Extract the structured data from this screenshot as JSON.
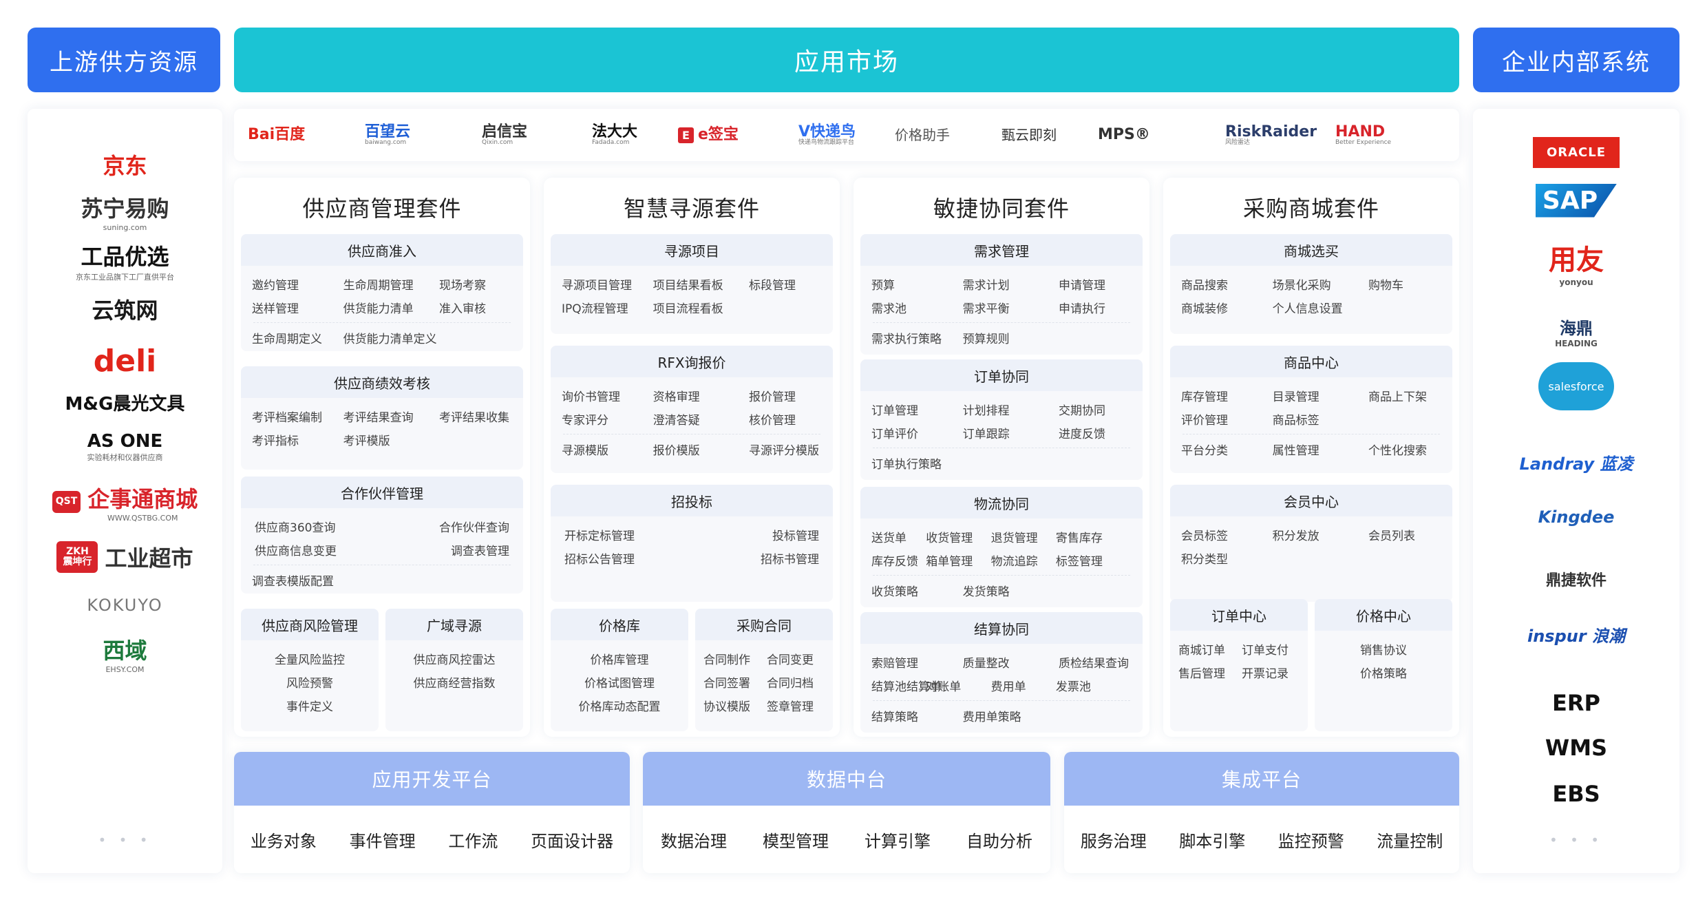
{
  "headers": {
    "left": "上游供方资源",
    "center": "应用市场",
    "right": "企业内部系统"
  },
  "left_logos": [
    {
      "name": "jd",
      "text": "京东",
      "color": "#e1251b"
    },
    {
      "name": "suning",
      "text": "苏宁易购",
      "sub": "suning.com",
      "color": "#333333"
    },
    {
      "name": "gongpin",
      "text": "工品优选",
      "sub": "京东工业品旗下工厂直供平台",
      "color": "#111111"
    },
    {
      "name": "yunzhu",
      "text": "云筑网",
      "color": "#1a1a1a"
    },
    {
      "name": "deli",
      "text": "deli",
      "color": "#e1251b"
    },
    {
      "name": "mg",
      "text": "M&G晨光文具",
      "color": "#111111"
    },
    {
      "name": "asone",
      "text": "AS ONE",
      "sub": "实验耗材和仪器供应商",
      "color": "#111111"
    },
    {
      "name": "qst",
      "text": "企事通商城",
      "badge": "QST",
      "sub": "WWW.QSTBG.COM",
      "color": "#d8242b"
    },
    {
      "name": "zkh",
      "text": "工业超市",
      "badge": "ZKH 震坤行",
      "color": "#333333"
    },
    {
      "name": "kokuyo",
      "text": "KOKUYO",
      "color": "#777777"
    },
    {
      "name": "ehsy",
      "text": "西域",
      "sub": "EHSY.COM",
      "color": "#1d7a3c"
    }
  ],
  "left_more": "• • •",
  "partners": [
    {
      "name": "baidu",
      "text": "Bai百度",
      "color": "#e1251b"
    },
    {
      "name": "baiwangyun",
      "text": "百望云",
      "sub": "baiwang.com",
      "color": "#1f5fd6"
    },
    {
      "name": "qixinbao",
      "text": "启信宝",
      "sub": "Qixin.com",
      "color": "#333333"
    },
    {
      "name": "fadada",
      "text": "法大大",
      "sub": "Fadada.com",
      "color": "#111111"
    },
    {
      "name": "esign",
      "text": "e签宝",
      "badge": "E",
      "color": "#d8242b"
    },
    {
      "name": "kuaidiniao",
      "text": "V快递鸟",
      "sub": "快递鸟物流跟踪平台",
      "color": "#2f6fef"
    },
    {
      "name": "price-helper",
      "text": "价格助手",
      "color": "#555555"
    },
    {
      "name": "zhenyun",
      "text": "甄云即刻",
      "color": "#333333"
    },
    {
      "name": "mps",
      "text": "MPS®",
      "color": "#333333"
    },
    {
      "name": "riskraider",
      "text": "RiskRaider",
      "sub": "风险雷达",
      "color": "#2c3e6b"
    },
    {
      "name": "hand",
      "text": "HAND",
      "sub": "Better Experience",
      "color": "#d8242b"
    }
  ],
  "suites": [
    {
      "title": "供应商管理套件",
      "blocks": [
        {
          "header": "供应商准入",
          "rows": [
            [
              "邀约管理",
              "生命周期管理",
              "现场考察"
            ],
            [
              "送样管理",
              "供货能力清单",
              "准入审核"
            ],
            [
              "生命周期定义",
              "供货能力清单定义"
            ]
          ]
        },
        {
          "header": "供应商绩效考核",
          "rows": [
            [
              "考评档案编制",
              "考评结果查询",
              "考评结果收集"
            ],
            [
              "考评指标",
              "考评模版"
            ]
          ]
        },
        {
          "header": "合作伙伴管理",
          "rows": [
            [
              "供应商360查询",
              "合作伙伴查询"
            ],
            [
              "供应商信息变更",
              "调查表管理"
            ],
            [
              "调查表模版配置"
            ]
          ]
        },
        {
          "header": "供应商风险管理",
          "rows": [
            [
              "全量风险监控"
            ],
            [
              "风险预警"
            ],
            [
              "事件定义"
            ]
          ]
        },
        {
          "header": "广域寻源",
          "rows": [
            [
              "供应商风控雷达"
            ],
            [
              "供应商经营指数"
            ]
          ]
        }
      ]
    },
    {
      "title": "智慧寻源套件",
      "blocks": [
        {
          "header": "寻源项目",
          "rows": [
            [
              "寻源项目管理",
              "项目结果看板",
              "标段管理"
            ],
            [
              "IPQ流程管理",
              "项目流程看板"
            ]
          ]
        },
        {
          "header": "RFX询报价",
          "rows": [
            [
              "询价书管理",
              "资格审理",
              "报价管理"
            ],
            [
              "专家评分",
              "澄清答疑",
              "核价管理"
            ],
            [
              "寻源模版",
              "报价模版",
              "寻源评分模版"
            ]
          ]
        },
        {
          "header": "招投标",
          "rows": [
            [
              "开标定标管理",
              "投标管理"
            ],
            [
              "招标公告管理",
              "招标书管理"
            ]
          ]
        },
        {
          "header": "价格库",
          "rows": [
            [
              "价格库管理"
            ],
            [
              "价格试图管理"
            ],
            [
              "价格库动态配置"
            ]
          ]
        },
        {
          "header": "采购合同",
          "rows": [
            [
              "合同制作",
              "合同变更"
            ],
            [
              "合同签署",
              "合同归档"
            ],
            [
              "协议模版",
              "签章管理"
            ]
          ]
        }
      ]
    },
    {
      "title": "敏捷协同套件",
      "blocks": [
        {
          "header": "需求管理",
          "rows": [
            [
              "预算",
              "需求计划",
              "申请管理"
            ],
            [
              "需求池",
              "需求平衡",
              "申请执行"
            ],
            [
              "需求执行策略",
              "预算规则"
            ]
          ]
        },
        {
          "header": "订单协同",
          "rows": [
            [
              "订单管理",
              "计划排程",
              "交期协同"
            ],
            [
              "订单评价",
              "订单跟踪",
              "进度反馈"
            ],
            [
              "订单执行策略"
            ]
          ]
        },
        {
          "header": "物流协同",
          "rows": [
            [
              "送货单",
              "收货管理",
              "退货管理",
              "寄售库存"
            ],
            [
              "库存反馈",
              "箱单管理",
              "物流追踪",
              "标签管理"
            ],
            [
              "收货策略",
              "发货策略"
            ]
          ]
        },
        {
          "header": "结算协同",
          "rows": [
            [
              "索赔管理",
              "质量整改",
              "质检结果查询"
            ],
            [
              "结算池结算单",
              "对账单",
              "费用单",
              "发票池"
            ],
            [
              "结算策略",
              "费用单策略"
            ]
          ]
        }
      ]
    },
    {
      "title": "采购商城套件",
      "blocks": [
        {
          "header": "商城选买",
          "rows": [
            [
              "商品搜索",
              "场景化采购",
              "购物车"
            ],
            [
              "商城装修",
              "个人信息设置"
            ]
          ]
        },
        {
          "header": "商品中心",
          "rows": [
            [
              "库存管理",
              "目录管理",
              "商品上下架"
            ],
            [
              "评价管理",
              "商品标签"
            ],
            [
              "平台分类",
              "属性管理",
              "个性化搜索"
            ]
          ]
        },
        {
          "header": "会员中心",
          "rows": [
            [
              "会员标签",
              "积分发放",
              "会员列表"
            ],
            [
              "积分类型"
            ]
          ]
        },
        {
          "header": "订单中心",
          "rows": [
            [
              "商城订单",
              "订单支付"
            ],
            [
              "售后管理",
              "开票记录"
            ]
          ]
        },
        {
          "header": "价格中心",
          "rows": [
            [
              "销售协议"
            ],
            [
              "价格策略"
            ]
          ]
        }
      ]
    }
  ],
  "platforms": [
    {
      "title": "应用开发平台",
      "items": [
        "业务对象",
        "事件管理",
        "工作流",
        "页面设计器"
      ]
    },
    {
      "title": "数据中台",
      "items": [
        "数据治理",
        "模型管理",
        "计算引擎",
        "自助分析"
      ]
    },
    {
      "title": "集成平台",
      "items": [
        "服务治理",
        "脚本引擎",
        "监控预警",
        "流量控制"
      ]
    }
  ],
  "right_logos": [
    {
      "name": "oracle",
      "text": "ORACLE",
      "color": "#e1251b"
    },
    {
      "name": "sap",
      "text": "SAP",
      "color": "#0a6ed1"
    },
    {
      "name": "yonyou",
      "text": "用友",
      "sub": "yonyou",
      "color": "#e1251b"
    },
    {
      "name": "heading",
      "text": "海鼎",
      "sub": "HEADING",
      "color": "#1f3a66"
    },
    {
      "name": "salesforce",
      "text": "salesforce",
      "color": "#1798c1"
    },
    {
      "name": "landray",
      "text": "Landray 蓝凌",
      "color": "#1e5fcf"
    },
    {
      "name": "kingdee",
      "text": "Kingdee",
      "color": "#1f5fb8"
    },
    {
      "name": "dingjie",
      "text": "鼎捷软件",
      "color": "#333333"
    },
    {
      "name": "inspur",
      "text": "inspur 浪潮",
      "color": "#1b4fb0"
    },
    {
      "name": "erp",
      "text": "ERP",
      "color": "#111111"
    },
    {
      "name": "wms",
      "text": "WMS",
      "color": "#111111"
    },
    {
      "name": "ebs",
      "text": "EBS",
      "color": "#111111"
    }
  ],
  "right_more": "• • •"
}
